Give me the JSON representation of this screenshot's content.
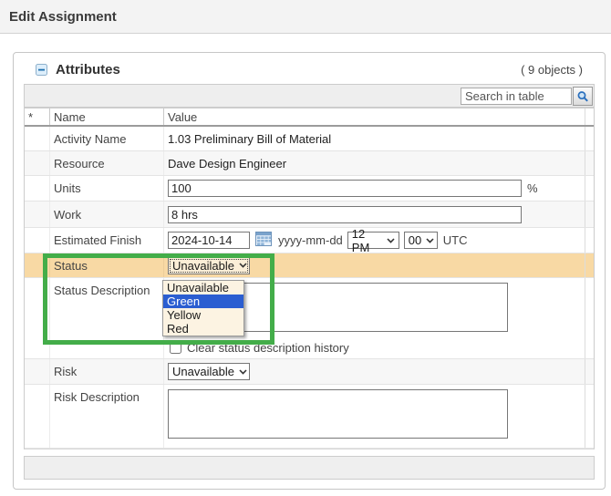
{
  "window": {
    "title": "Edit Assignment"
  },
  "panel": {
    "title": "Attributes",
    "objects_count": "( 9 objects )",
    "search_placeholder": "Search in table"
  },
  "table": {
    "headers": {
      "star": "*",
      "name": "Name",
      "value": "Value"
    },
    "rows": {
      "activity": {
        "label": "Activity Name",
        "value": "1.03 Preliminary Bill of Material"
      },
      "resource": {
        "label": "Resource",
        "value": "Dave Design Engineer"
      },
      "units": {
        "label": "Units",
        "value": "100",
        "suffix": "%"
      },
      "work": {
        "label": "Work",
        "value": "8 hrs"
      },
      "estimated_finish": {
        "label": "Estimated Finish",
        "date": "2024-10-14",
        "format_hint": "yyyy-mm-dd",
        "hour": "12 PM",
        "minute": "00",
        "timezone": "UTC"
      },
      "status": {
        "label": "Status",
        "value": "Unavailable"
      },
      "status_description": {
        "label": "Status Description",
        "value": "",
        "checkbox_label": "Clear status description history",
        "checkbox_checked": false
      },
      "risk": {
        "label": "Risk",
        "value": "Unavailable"
      },
      "risk_description": {
        "label": "Risk Description",
        "value": ""
      }
    }
  },
  "status_dropdown": {
    "options": [
      "Unavailable",
      "Green",
      "Yellow",
      "Red"
    ],
    "highlighted": "Green"
  },
  "colors": {
    "status_row_highlight": "#f8d9a4",
    "dropdown_selected": "#2b5ed1",
    "annotation_green": "#43ad49"
  }
}
